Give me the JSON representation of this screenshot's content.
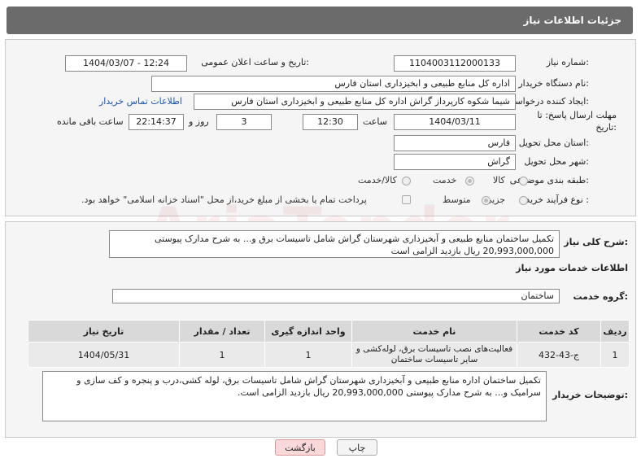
{
  "header": {
    "title": "جزئیات اطلاعات نیاز"
  },
  "form": {
    "need_number_label": "شماره نیاز:",
    "need_number": "1104003112000133",
    "announce_label": "تاریخ و ساعت اعلان عمومی:",
    "announce_value": "1404/03/07 - 12:24",
    "buyer_org_label": "نام دستگاه خریدار:",
    "buyer_org": "اداره کل منابع طبیعی و ابخیزداری استان فارس",
    "creator_label": "ایجاد کننده درخواست:",
    "creator": "شیما شکوه کارپرداز گراش اداره کل منابع طبیعی و ابخیزداری استان فارس",
    "contact_link": "اطلاعات تماس خریدار",
    "deadline_label": "مهلت ارسال پاسخ: تا تاریخ:",
    "deadline_date": "1404/03/11",
    "time_label": "ساعت",
    "deadline_time": "12:30",
    "days_value": "3",
    "days_label": "روز و",
    "remaining_time": "22:14:37",
    "remaining_label": "ساعت باقی مانده",
    "province_label": "استان محل تحویل:",
    "province": "فارس",
    "city_label": "شهر محل تحویل:",
    "city": "گراش",
    "category_label": "طبقه بندی موضوعی:",
    "category_options": [
      "کالا",
      "خدمت",
      "کالا/خدمت"
    ],
    "category_selected": "خدمت",
    "process_label": "نوع فرآیند خرید :",
    "process_options": [
      "جزیی",
      "متوسط"
    ],
    "process_selected": "متوسط",
    "payment_note": "پرداخت تمام یا بخشی از مبلغ خرید،از محل \"اسناد خزانه اسلامی\" خواهد بود."
  },
  "summary": {
    "label": "شرح کلی نیاز:",
    "text": "تکمیل ساختمان  منابع طبیعی و آبخیزداری شهرستان گراش شامل تاسیسات برق و... به شرح مدارک پیوستی 20,993,000,000 ریال بازدید الزامی است"
  },
  "services": {
    "title": "اطلاعات خدمات مورد نیاز",
    "group_label": "گروه خدمت:",
    "group_value": "ساختمان",
    "columns": [
      "ردیف",
      "کد خدمت",
      "نام خدمت",
      "واحد اندازه گیری",
      "تعداد / مقدار",
      "تاریخ نیاز"
    ],
    "rows": [
      [
        "1",
        "ج-43-432",
        "فعالیت‌های نصب تاسیسات برق، لوله‌کشی و سایر تاسیسات ساختمان",
        "1",
        "1",
        "1404/05/31"
      ]
    ]
  },
  "buyer_notes": {
    "label": "توضیحات خریدار:",
    "text": "تکمیل ساختمان اداره منابع طبیعی و آبخیزداری شهرستان گراش شامل تاسیسات برق، لوله کشی،درب و پنجره و کف سازی و سرامیک و... به شرح مدارک پیوستی 20,993,000,000 ریال بازدید الزامی است."
  },
  "buttons": {
    "print": "چاپ",
    "back": "بازگشت"
  },
  "colors": {
    "header_bg": "#6b6b6b",
    "link": "#1a55b0",
    "back_btn": "#f9d9d9"
  }
}
